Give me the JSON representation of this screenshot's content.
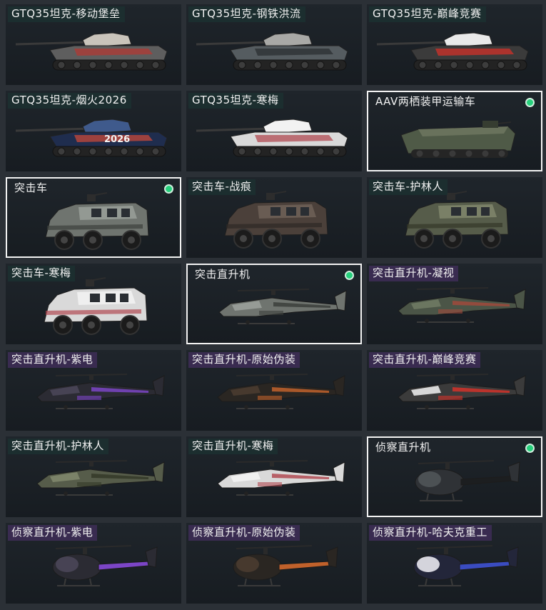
{
  "colors": {
    "label_bg": "#1c3030",
    "label_bg_purple": "#3c2c54",
    "selected_border": "#f2f2f2",
    "equipped_dot": "#26d07c"
  },
  "items": [
    {
      "name": "GTQ35坦克-移动堡垒",
      "type": "tank",
      "skin": "fortress",
      "selected": false,
      "equipped": false,
      "tag": "teal"
    },
    {
      "name": "GTQ35坦克-钢铁洪流",
      "type": "tank",
      "skin": "steel",
      "selected": false,
      "equipped": false,
      "tag": "teal"
    },
    {
      "name": "GTQ35坦克-巅峰竞赛",
      "type": "tank",
      "skin": "race",
      "selected": false,
      "equipped": false,
      "tag": "teal"
    },
    {
      "name": "GTQ35坦克-烟火2026",
      "type": "tank",
      "skin": "fireworks",
      "selected": false,
      "equipped": false,
      "tag": "teal",
      "decal": "2026"
    },
    {
      "name": "GTQ35坦克-寒梅",
      "type": "tank",
      "skin": "plum",
      "selected": false,
      "equipped": false,
      "tag": "teal"
    },
    {
      "name": "AAV两栖装甲运输车",
      "type": "aav",
      "skin": "olive",
      "selected": true,
      "equipped": true,
      "tag": "teal"
    },
    {
      "name": "突击车",
      "type": "truck",
      "skin": "gray",
      "selected": true,
      "equipped": true,
      "tag": "teal"
    },
    {
      "name": "突击车-战痕",
      "type": "truck",
      "skin": "battle",
      "selected": false,
      "equipped": false,
      "tag": "teal"
    },
    {
      "name": "突击车-护林人",
      "type": "truck",
      "skin": "forest",
      "selected": false,
      "equipped": false,
      "tag": "teal"
    },
    {
      "name": "突击车-寒梅",
      "type": "truck",
      "skin": "plum",
      "selected": false,
      "equipped": false,
      "tag": "teal"
    },
    {
      "name": "突击直升机",
      "type": "heli",
      "skin": "gray",
      "selected": true,
      "equipped": true,
      "tag": "teal"
    },
    {
      "name": "突击直升机-凝视",
      "type": "heli",
      "skin": "gaze",
      "selected": false,
      "equipped": false,
      "tag": "purple"
    },
    {
      "name": "突击直升机-紫电",
      "type": "heli",
      "skin": "violet",
      "selected": false,
      "equipped": false,
      "tag": "purple"
    },
    {
      "name": "突击直升机-原始伪装",
      "type": "heli",
      "skin": "primal",
      "selected": false,
      "equipped": false,
      "tag": "purple"
    },
    {
      "name": "突击直升机-巅峰竞赛",
      "type": "heli",
      "skin": "race",
      "selected": false,
      "equipped": false,
      "tag": "purple"
    },
    {
      "name": "突击直升机-护林人",
      "type": "heli",
      "skin": "forest",
      "selected": false,
      "equipped": false,
      "tag": "teal"
    },
    {
      "name": "突击直升机-寒梅",
      "type": "heli",
      "skin": "plum",
      "selected": false,
      "equipped": false,
      "tag": "teal"
    },
    {
      "name": "侦察直升机",
      "type": "scout",
      "skin": "dark",
      "selected": true,
      "equipped": true,
      "tag": "teal"
    },
    {
      "name": "侦察直升机-紫电",
      "type": "scout",
      "skin": "violet",
      "selected": false,
      "equipped": false,
      "tag": "purple"
    },
    {
      "name": "侦察直升机-原始伪装",
      "type": "scout",
      "skin": "primal",
      "selected": false,
      "equipped": false,
      "tag": "purple"
    },
    {
      "name": "侦察直升机-哈夫克重工",
      "type": "scout",
      "skin": "haavk",
      "selected": false,
      "equipped": false,
      "tag": "purple"
    }
  ]
}
